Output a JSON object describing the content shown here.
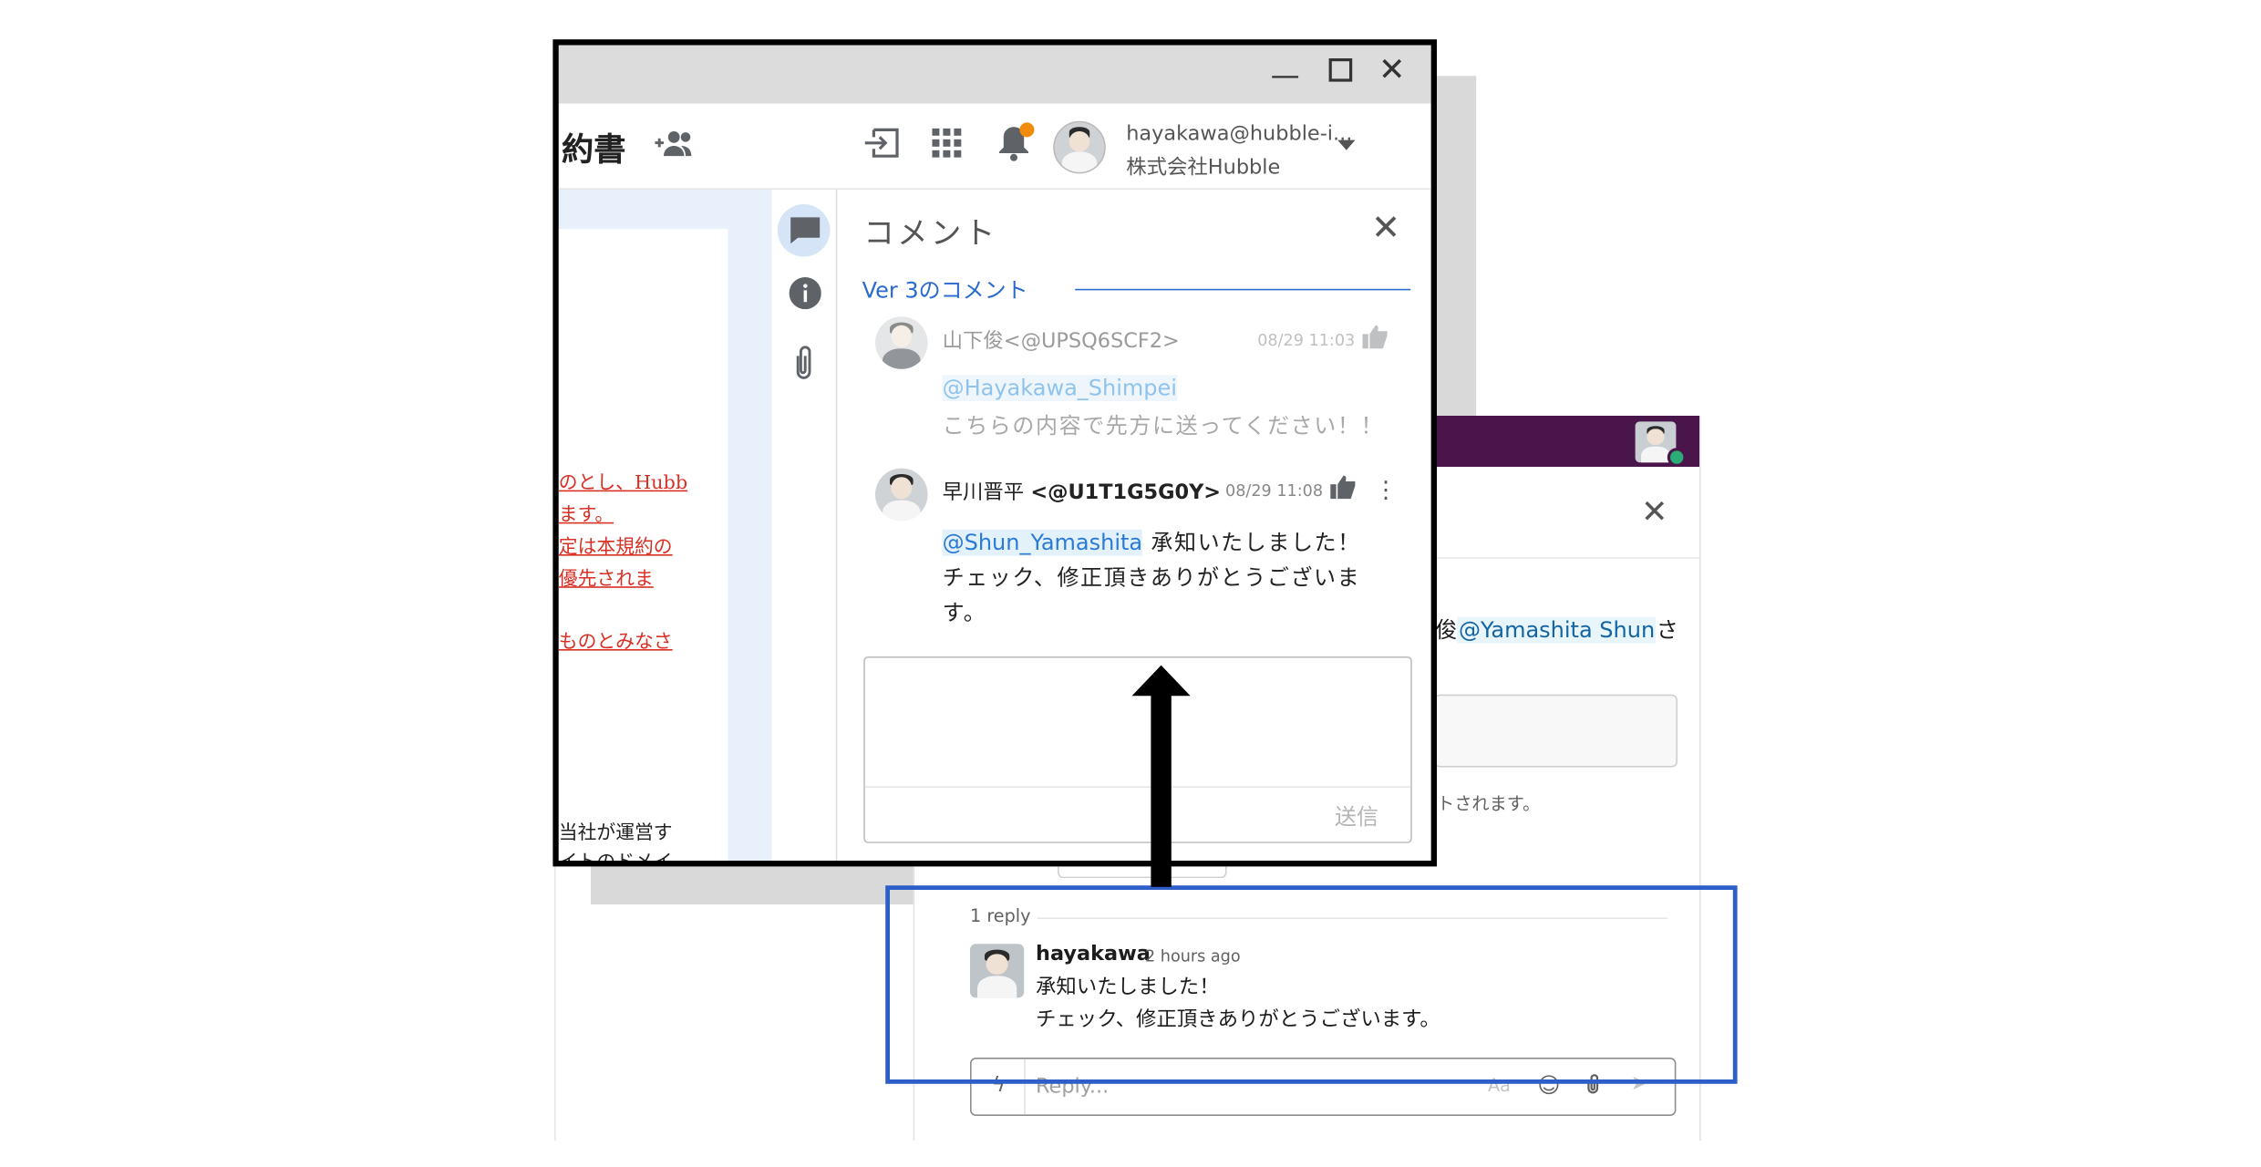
{
  "window": {
    "doc_title": "約書",
    "user": {
      "email": "hayakawa@hubble-i...",
      "org": "株式会社Hubble"
    },
    "icons": {
      "share_users": "group-add-icon",
      "import": "import-icon",
      "apps": "apps-grid-icon",
      "notifications": "bell-icon",
      "caret": "chevron-down-icon",
      "rail": [
        "comment-icon",
        "info-icon",
        "paperclip-icon"
      ]
    },
    "doc_text": {
      "red_lines": [
        "のとし、Hubb",
        "ます。",
        "定は本規約の",
        "優先されま",
        "ものとみなさ"
      ],
      "black_lines": [
        "当社が運営す",
        "イトのドメイ"
      ]
    },
    "comments_panel": {
      "title": "コメント",
      "version_label": "Ver 3のコメント",
      "comments": [
        {
          "author": "山下俊<@UPSQ6SCF2>",
          "time": "08/29 11:03",
          "mention": "@Hayakawa_Shimpei",
          "text": "こちらの内容で先方に送ってください！！"
        },
        {
          "author_name": "早川晋平",
          "author_id": "<@U1T1G5G0Y>",
          "time": "08/29 11:08",
          "mention": "@Shun_Yamashita",
          "text_after_mention": "承知いたしました！",
          "line2": "チェック、修正頂きありがとうございま",
          "line3": "す。"
        }
      ],
      "send_label": "送信"
    }
  },
  "slack": {
    "message_tail_prefix": "俊",
    "message_mention": "@Yamashita Shun",
    "message_tail_suffix": "さ",
    "share_note": "トされます。",
    "reply_count": "1 reply",
    "reply": {
      "user": "hayakawa",
      "time": "2 hours ago",
      "line1": "承知いたしました！",
      "line2": "チェック、修正頂きありがとうございます。"
    },
    "composer": {
      "placeholder": "Reply...",
      "format_label": "Aa"
    }
  },
  "colors": {
    "slack_header": "#4a154b",
    "highlight": "#2e5fc9",
    "link_blue": "#2a6acf",
    "notification_dot": "#f28b0c"
  }
}
